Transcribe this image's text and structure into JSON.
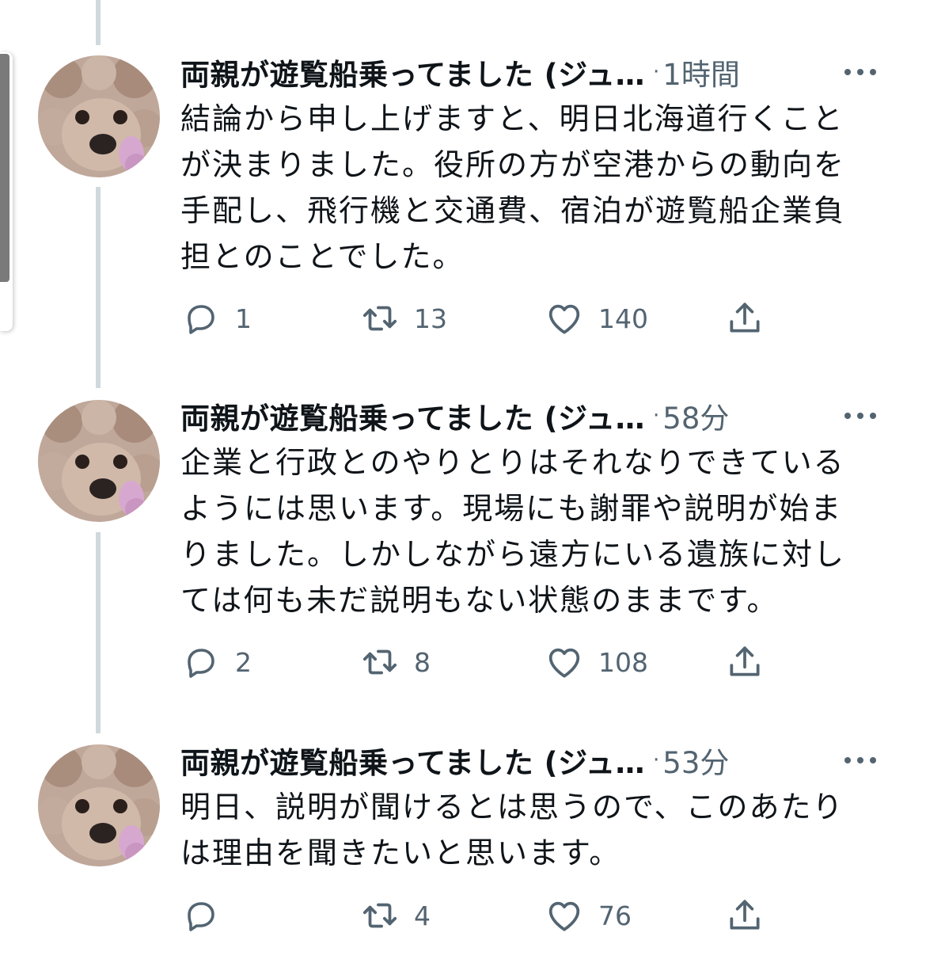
{
  "tweets": [
    {
      "author": "両親が遊覧船乗ってました (ジュ…",
      "separator": "·",
      "time": "1時間",
      "lines": [
        "結論から申し上げますと、明日北海道行くこと",
        "が決まりました。役所の方が空港からの動向を",
        "手配し、飛行機と交通費、宿泊が遊覧船企業負",
        "担とのことでした。"
      ],
      "replies": "1",
      "retweets": "13",
      "likes": "140"
    },
    {
      "author": "両親が遊覧船乗ってました (ジュ…",
      "separator": "·",
      "time": "58分",
      "lines": [
        "企業と行政とのやりとりはそれなりできている",
        "ようには思います。現場にも謝罪や説明が始ま",
        "りました。しかしながら遠方にいる遺族に対し",
        "ては何も未だ説明もない状態のままです。"
      ],
      "replies": "2",
      "retweets": "8",
      "likes": "108"
    },
    {
      "author": "両親が遊覧船乗ってました (ジュ…",
      "separator": "·",
      "time": "53分",
      "lines": [
        "明日、説明が聞けるとは思うので、このあたり",
        "は理由を聞きたいと思います。"
      ],
      "replies": "",
      "retweets": "4",
      "likes": "76"
    }
  ],
  "icons": {
    "reply": "speech-bubble-icon",
    "retweet": "retweet-arrows-icon",
    "like": "heart-icon",
    "share": "share-upload-icon",
    "more": "more-dots-icon",
    "avatar": "poodle-dog-photo"
  },
  "colors": {
    "text": "#0f1419",
    "secondary": "#536471",
    "thread_line": "#cfd9de"
  }
}
